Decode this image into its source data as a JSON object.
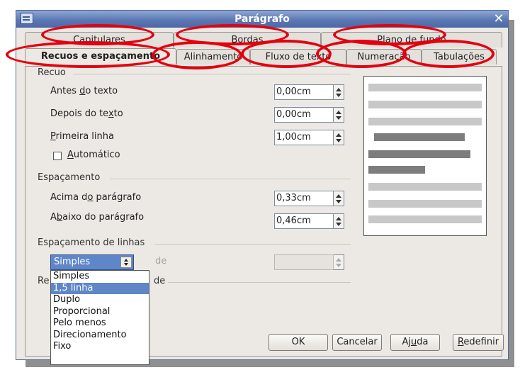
{
  "window": {
    "title": "Parágrafo"
  },
  "tabs": {
    "row1": [
      "Capitulares",
      "Bordas",
      "Plano de fundo"
    ],
    "row2": [
      "Recuos e espaçamento",
      "Alinhamento",
      "Fluxo de texto",
      "Numeração",
      "Tabulações"
    ],
    "active": "Recuos e espaçamento"
  },
  "indent": {
    "section": "Recuo",
    "before_text": {
      "pre": "Antes ",
      "key": "d",
      "post": "o texto",
      "value": "0,00cm"
    },
    "after_text": {
      "pre": "Depois do te",
      "key": "x",
      "post": "to",
      "value": "0,00cm"
    },
    "first_line": {
      "pre": "",
      "key": "P",
      "post": "rimeira linha",
      "value": "1,00cm"
    },
    "automatic": {
      "pre": "",
      "key": "A",
      "post": "utomático",
      "checked": false
    }
  },
  "spacing": {
    "section": "Espaçamento",
    "above": {
      "pre": "Acima d",
      "key": "o",
      "post": " parágrafo",
      "value": "0,33cm"
    },
    "below": {
      "pre": "A",
      "key": "b",
      "post": "aixo do parágrafo",
      "value": "0,46cm"
    }
  },
  "line_spacing": {
    "section": "Espaçamento de linhas",
    "selected": "Simples",
    "of_label": "de",
    "options": [
      "Simples",
      "1,5 linha",
      "Duplo",
      "Proporcional",
      "Pelo menos",
      "Direcionamento",
      "Fixo"
    ],
    "highlighted": "1,5 linha",
    "value": ""
  },
  "register": {
    "section_start": "Re",
    "section_end": "de"
  },
  "buttons": {
    "ok": "OK",
    "cancel": "Cancelar",
    "help": {
      "pre": "Aj",
      "key": "u",
      "post": "da"
    },
    "reset": {
      "pre": "",
      "key": "R",
      "post": "edefinir"
    }
  },
  "colors": {
    "titlebar": "#5b78b4",
    "selection": "#5e86c8",
    "annotation": "#e3000f",
    "dialog_bg": "#ece9e5"
  }
}
